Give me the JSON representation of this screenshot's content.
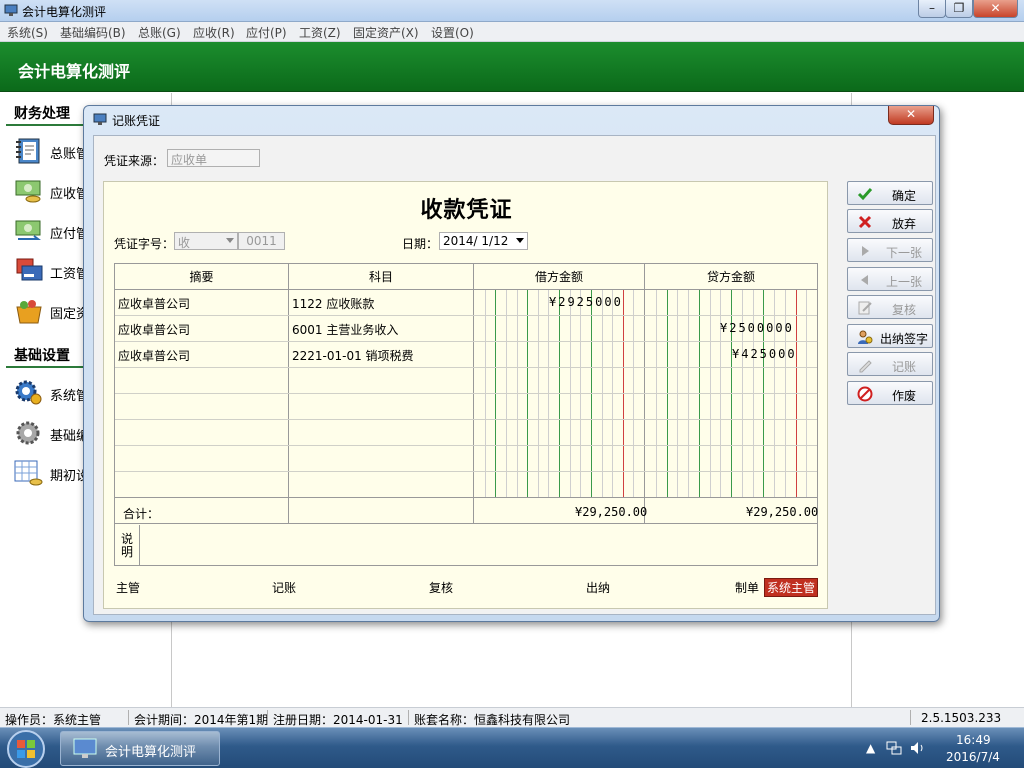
{
  "app": {
    "title": "会计电算化测评",
    "banner": "会计电算化测评"
  },
  "menu": [
    "系统(S)",
    "基础编码(B)",
    "总账(G)",
    "应收(R)",
    "应付(P)",
    "工资(Z)",
    "固定资产(X)",
    "设置(O)"
  ],
  "sidebar": {
    "sec1": "财务处理",
    "items1": [
      {
        "label": "总账管"
      },
      {
        "label": "应收管"
      },
      {
        "label": "应付管"
      },
      {
        "label": "工资管"
      },
      {
        "label": "固定资"
      }
    ],
    "sec2": "基础设置",
    "items2": [
      {
        "label": "系统管"
      },
      {
        "label": "基础编"
      },
      {
        "label": "期初设"
      }
    ]
  },
  "dialog": {
    "title": "记账凭证",
    "source_label": "凭证来源：",
    "source_value": "应收单",
    "voucher_title": "收款凭证",
    "word_label": "凭证字号：",
    "word_value": "收",
    "number_value": "0011",
    "date_label": "日期：",
    "date_value": "2014/ 1/12",
    "headers": [
      "摘要",
      "科目",
      "借方金额",
      "贷方金额"
    ],
    "rows": [
      {
        "summary": "应收卓普公司",
        "account": "1122 应收账款",
        "debit": "¥2925000",
        "credit": ""
      },
      {
        "summary": "应收卓普公司",
        "account": "6001 主营业务收入",
        "debit": "",
        "credit": "¥2500000"
      },
      {
        "summary": "应收卓普公司",
        "account": "2221-01-01 销项税费",
        "debit": "",
        "credit": "¥425000"
      }
    ],
    "total_label": "合计：",
    "total_debit": "¥29,250.00",
    "total_credit": "¥29,250.00",
    "notes_label": "说明",
    "sigs": {
      "supervisor": "主管",
      "posting": "记账",
      "review": "复核",
      "cashier": "出纳",
      "maker": "制单",
      "maker_value": "系统主管"
    },
    "buttons": [
      {
        "label": "确定",
        "enabled": true
      },
      {
        "label": "放弃",
        "enabled": true
      },
      {
        "label": "下一张",
        "enabled": false
      },
      {
        "label": "上一张",
        "enabled": false
      },
      {
        "label": "复核",
        "enabled": false
      },
      {
        "label": "出纳签字",
        "enabled": true
      },
      {
        "label": "记账",
        "enabled": false
      },
      {
        "label": "作废",
        "enabled": true
      }
    ]
  },
  "status": {
    "operator": "操作员：系统主管",
    "period": "会计期间：2014年第1期",
    "reg": "注册日期：2014-01-31",
    "book": "账套名称：恒鑫科技有限公司",
    "version": "2.5.1503.233"
  },
  "taskbar": {
    "app": "会计电算化测评",
    "time": "16:49",
    "date": "2016/7/4"
  },
  "colors": {
    "banner": "#0b6a1a",
    "close": "#c03a22",
    "maker_badge": "#c03020"
  }
}
